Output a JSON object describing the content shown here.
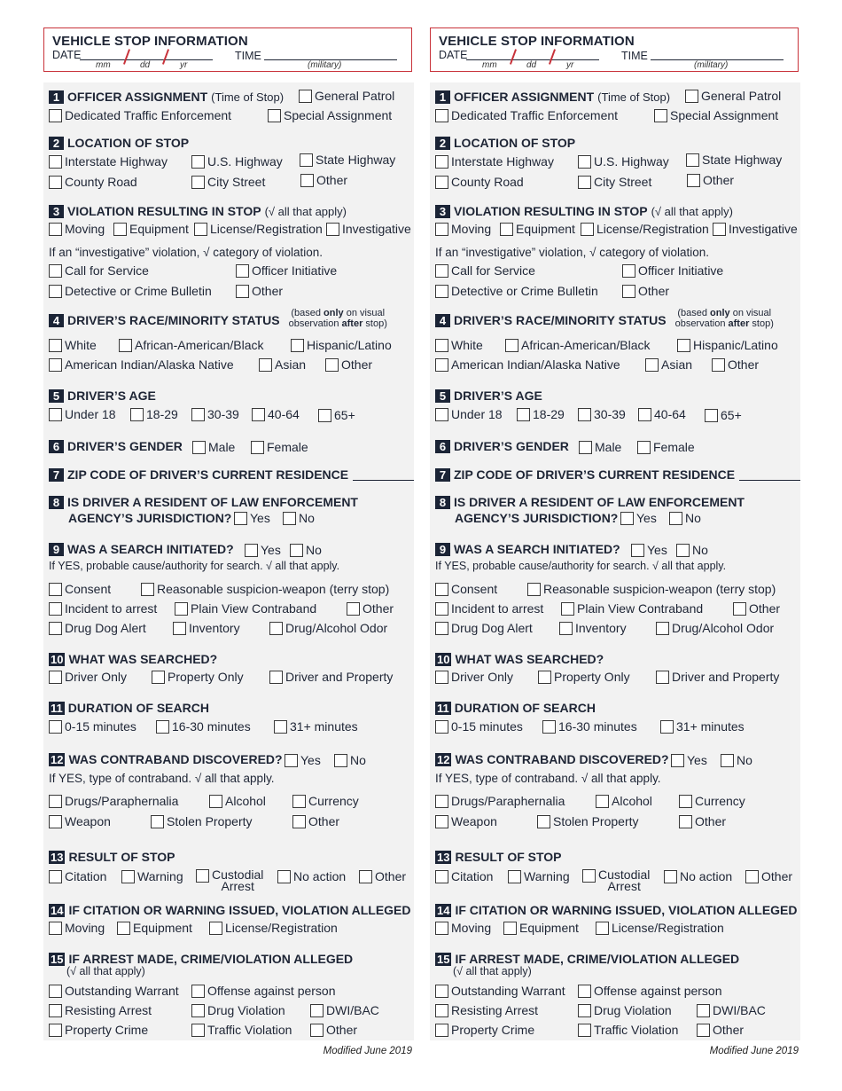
{
  "header": {
    "title": "VEHICLE STOP INFORMATION",
    "date_label": "DATE",
    "date_parts": [
      "mm",
      "dd",
      "yr"
    ],
    "time_label": "TIME",
    "time_sub": "(military)"
  },
  "sections": {
    "s1": {
      "num": "1",
      "title": "OFFICER ASSIGNMENT",
      "note": "(Time of Stop)",
      "options": [
        "General Patrol",
        "Dedicated Traffic Enforcement",
        "Special Assignment"
      ]
    },
    "s2": {
      "num": "2",
      "title": "LOCATION OF STOP",
      "options": [
        "Interstate Highway",
        "U.S. Highway",
        "State Highway",
        "County Road",
        "City Street",
        "Other"
      ]
    },
    "s3": {
      "num": "3",
      "title": "VIOLATION RESULTING IN STOP",
      "note": "(√ all that apply)",
      "options": [
        "Moving",
        "Equipment",
        "License/Registration",
        "Investigative"
      ],
      "sub_note": "If an “investigative” violation, √ category of violation.",
      "sub_options": [
        "Call for Service",
        "Officer Initiative",
        "Detective or Crime Bulletin",
        "Other"
      ]
    },
    "s4": {
      "num": "4",
      "title": "DRIVER’S RACE/MINORITY STATUS",
      "note_line1_a": "(based ",
      "note_line1_b": "only",
      "note_line1_c": " on visual",
      "note_line2_a": "observation ",
      "note_line2_b": "after",
      "note_line2_c": " stop)",
      "options": [
        "White",
        "African-American/Black",
        "Hispanic/Latino",
        "American Indian/Alaska Native",
        "Asian",
        "Other"
      ]
    },
    "s5": {
      "num": "5",
      "title": "DRIVER’S AGE",
      "options": [
        "Under 18",
        "18-29",
        "30-39",
        "40-64",
        "65+"
      ]
    },
    "s6": {
      "num": "6",
      "title": "DRIVER’S GENDER",
      "options": [
        "Male",
        "Female"
      ]
    },
    "s7": {
      "num": "7",
      "title": "ZIP CODE OF DRIVER’S CURRENT RESIDENCE"
    },
    "s8": {
      "num": "8",
      "title_line1": "IS DRIVER A RESIDENT OF LAW ENFORCEMENT",
      "title_line2": "AGENCY’S JURISDICTION?",
      "options": [
        "Yes",
        "No"
      ]
    },
    "s9": {
      "num": "9",
      "title": "WAS A SEARCH INITIATED?",
      "options": [
        "Yes",
        "No"
      ],
      "sub_note": "If YES, probable cause/authority for search. √ all that apply.",
      "sub_options": [
        "Consent",
        "Reasonable suspicion-weapon (terry stop)",
        "Incident to arrest",
        "Plain View Contraband",
        "Other",
        "Drug Dog Alert",
        "Inventory",
        "Drug/Alcohol Odor"
      ]
    },
    "s10": {
      "num": "10",
      "title": "WHAT WAS SEARCHED?",
      "options": [
        "Driver Only",
        "Property Only",
        "Driver and Property"
      ]
    },
    "s11": {
      "num": "11",
      "title": "DURATION OF SEARCH",
      "options": [
        "0-15 minutes",
        "16-30 minutes",
        "31+ minutes"
      ]
    },
    "s12": {
      "num": "12",
      "title": "WAS CONTRABAND DISCOVERED?",
      "options": [
        "Yes",
        "No"
      ],
      "sub_note": "If YES, type of contraband. √ all that apply.",
      "sub_options": [
        "Drugs/Paraphernalia",
        "Alcohol",
        "Currency",
        "Weapon",
        "Stolen Property",
        "Other"
      ]
    },
    "s13": {
      "num": "13",
      "title": "RESULT OF STOP",
      "options": [
        "Citation",
        "Warning",
        "Custodial",
        "No action",
        "Other"
      ],
      "custodial_line2": "Arrest"
    },
    "s14": {
      "num": "14",
      "title": "IF CITATION OR WARNING ISSUED, VIOLATION ALLEGED",
      "options": [
        "Moving",
        "Equipment",
        "License/Registration"
      ]
    },
    "s15": {
      "num": "15",
      "title": "IF ARREST MADE, CRIME/VIOLATION ALLEGED",
      "note": "(√ all that apply)",
      "options": [
        "Outstanding Warrant",
        "Offense against person",
        "Resisting Arrest",
        "Drug Violation",
        "DWI/BAC",
        "Property Crime",
        "Traffic Violation",
        "Other"
      ]
    }
  },
  "footer": "Modified June 2019",
  "colors": {
    "accent_red": "#c8323a",
    "navy": "#1b2436",
    "panel_gray": "#f2f2f2"
  }
}
